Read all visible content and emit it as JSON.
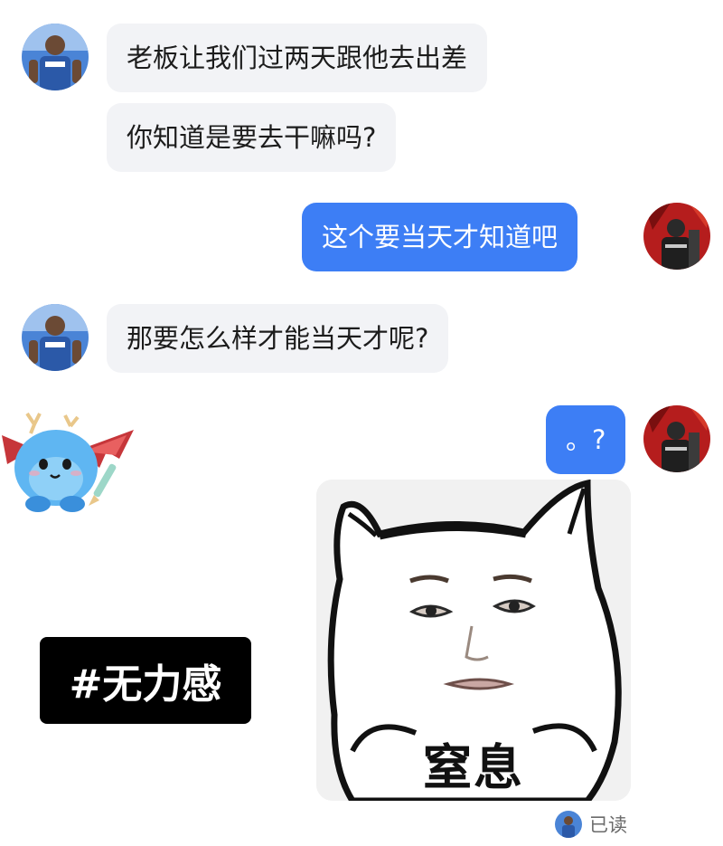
{
  "messages": [
    {
      "sender": "other",
      "text": "老板让我们过两天跟他去出差"
    },
    {
      "sender": "other",
      "text": "你知道是要去干嘛吗?"
    },
    {
      "sender": "me",
      "text": "这个要当天才知道吧"
    },
    {
      "sender": "other",
      "text": "那要怎么样才能当天才呢?"
    },
    {
      "sender": "me",
      "text": "。?"
    }
  ],
  "meme": {
    "caption": "窒息"
  },
  "tag": {
    "text": "#无力感"
  },
  "read_receipt": {
    "label": "已读"
  },
  "colors": {
    "outgoing_bubble": "#3d7ef5",
    "incoming_bubble": "#f2f3f6",
    "other_avatar_bg": "#3d75c9",
    "my_avatar_bg": "#b51d1d"
  },
  "icons": [
    "other-user-avatar",
    "my-avatar",
    "dragon-sticker",
    "cat-meme-sticker"
  ]
}
